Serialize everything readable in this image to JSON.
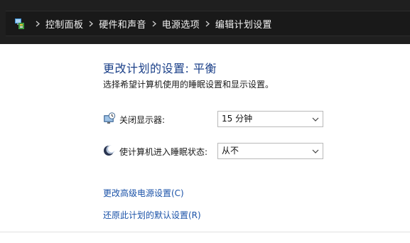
{
  "breadcrumb": {
    "root_icon": "control-panel-icon",
    "items": [
      "控制面板",
      "硬件和声音",
      "电源选项",
      "编辑计划设置"
    ]
  },
  "page": {
    "title": "更改计划的设置: 平衡",
    "subtitle": "选择希望计算机使用的睡眠设置和显示设置。"
  },
  "settings": {
    "display_off": {
      "icon": "monitor-clock-icon",
      "label": "关闭显示器:",
      "value": "15 分钟"
    },
    "sleep": {
      "icon": "moon-icon",
      "label": "使计算机进入睡眠状态:",
      "value": "从不"
    }
  },
  "links": {
    "advanced": "更改高级电源设置(C)",
    "restore": "还原此计划的默认设置(R)"
  },
  "colors": {
    "title": "#1a3f88",
    "link": "#1a52a8",
    "topbar": "#1f1f1f"
  }
}
